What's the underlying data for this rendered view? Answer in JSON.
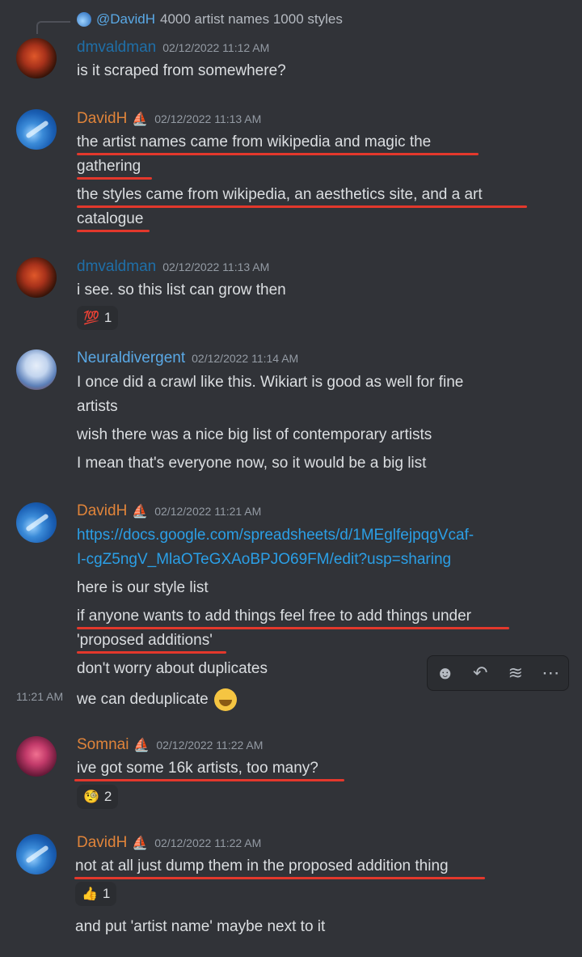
{
  "reply": {
    "name": "@DavidH",
    "text": "4000 artist names 1000 styles"
  },
  "messages": [
    {
      "user": "dmvaldman",
      "time": "02/12/2022 11:12 AM",
      "lines": [
        "is it scraped from somewhere?"
      ]
    },
    {
      "user": "DavidH",
      "time": "02/12/2022 11:13 AM",
      "lines": [
        "the artist names came from wikipedia and magic the",
        "gathering",
        "the styles came from wikipedia, an aesthetics site, and a art",
        "catalogue"
      ]
    },
    {
      "user": "dmvaldman",
      "time": "02/12/2022 11:13 AM",
      "lines": [
        "i see. so this list can grow then"
      ],
      "reaction": {
        "emoji": "💯",
        "count": "1"
      }
    },
    {
      "user": "Neuraldivergent",
      "time": "02/12/2022 11:14 AM",
      "lines": [
        "I once did a crawl like this. Wikiart is good as well for fine",
        "artists",
        "wish there was a nice big list of contemporary artists",
        "I mean that's everyone now, so it would be a big list"
      ]
    },
    {
      "user": "DavidH",
      "time": "02/12/2022 11:21 AM",
      "link": [
        "https://docs.google.com/spreadsheets/d/1MEglfejpqgVcaf-",
        "I-cgZ5ngV_MlaOTeGXAoBPJO69FM/edit?usp=sharing"
      ],
      "lines": [
        "here is our style list",
        "if anyone wants to add things feel free to add things under",
        "'proposed additions'",
        "don't worry about duplicates",
        "we can deduplicate"
      ],
      "side_time": "11:21 AM"
    },
    {
      "user": "Somnai",
      "time": "02/12/2022 11:22 AM",
      "lines": [
        "ive got some 16k artists, too many?"
      ],
      "reaction": {
        "emoji": "🧐",
        "count": "2"
      }
    },
    {
      "user": "DavidH",
      "time": "02/12/2022 11:22 AM",
      "lines": [
        "not at all just dump them in the proposed addition thing",
        "and put 'artist name' maybe next to it"
      ],
      "reaction": {
        "emoji": "👍",
        "count": "1"
      }
    }
  ],
  "toolbar": {
    "icons": [
      "emoji-reaction-icon",
      "reply-icon",
      "thread-icon",
      "more-icon"
    ]
  },
  "colors": {
    "background": "#313338",
    "highlight_underline": "#e3382c",
    "link": "#2b9fe6",
    "staff_name": "#e0843a"
  }
}
